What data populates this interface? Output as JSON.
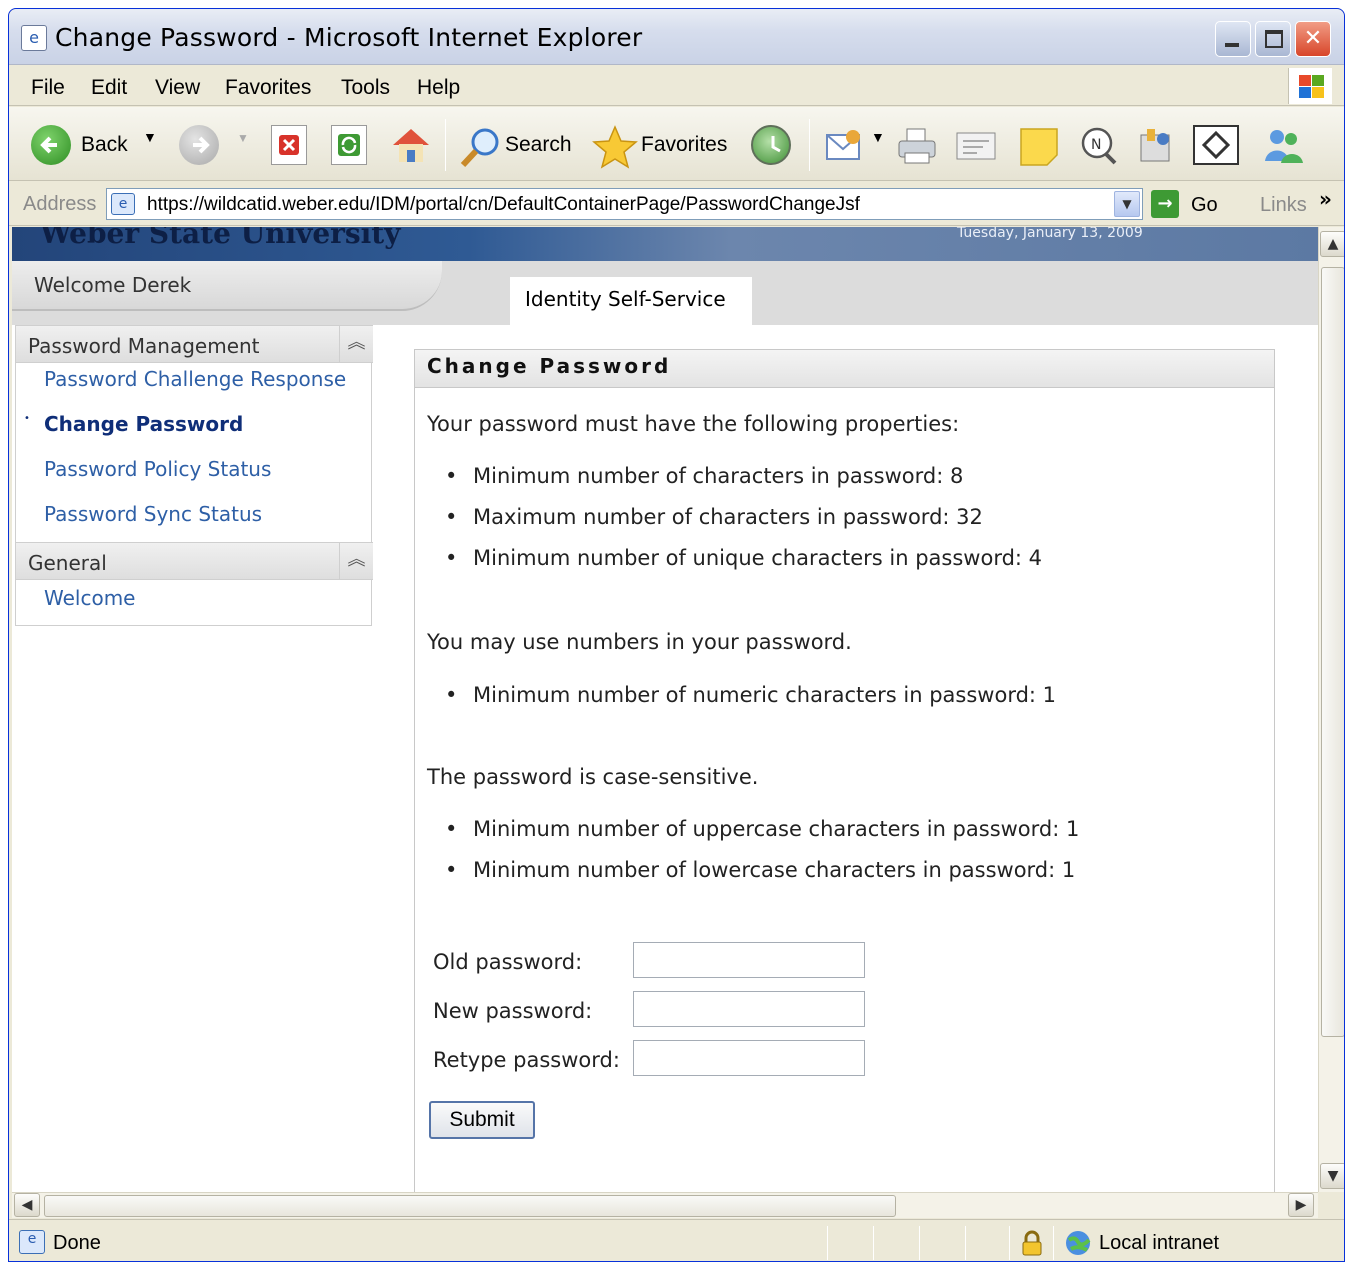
{
  "window": {
    "title": "Change Password - Microsoft Internet Explorer"
  },
  "menu": [
    "File",
    "Edit",
    "View",
    "Favorites",
    "Tools",
    "Help"
  ],
  "toolbar": {
    "back_label": "Back",
    "search_label": "Search",
    "favorites_label": "Favorites"
  },
  "address": {
    "label": "Address",
    "url": "https://wildcatid.weber.edu/IDM/portal/cn/DefaultContainerPage/PasswordChangeJsf",
    "go_label": "Go",
    "links_label": "Links",
    "more": "»"
  },
  "banner": {
    "title": "Weber State University",
    "date": "Tuesday, January 13, 2009"
  },
  "nav": {
    "welcome": "Welcome Derek",
    "active_tab": "Identity Self-Service"
  },
  "sidebar": {
    "sections": [
      {
        "title": "Password Management",
        "items": [
          {
            "label": "Password Challenge Response",
            "active": false
          },
          {
            "label": "Change Password",
            "active": true
          },
          {
            "label": "Password Policy Status",
            "active": false
          },
          {
            "label": "Password Sync Status",
            "active": false
          }
        ]
      },
      {
        "title": "General",
        "items": [
          {
            "label": "Welcome",
            "active": false
          }
        ]
      }
    ],
    "collapse_glyph": "︽"
  },
  "panel": {
    "title": "Change Password",
    "intro": "Your password must have the following properties:",
    "rules_general": [
      "Minimum number of characters in password: 8",
      "Maximum number of characters in password: 32",
      "Minimum number of unique characters in password: 4"
    ],
    "numbers_intro": "You may use numbers in your password.",
    "rules_numeric": [
      "Minimum number of numeric characters in password: 1"
    ],
    "case_intro": "The password is case-sensitive.",
    "rules_case": [
      "Minimum number of uppercase characters in password: 1",
      "Minimum number of lowercase characters in password: 1"
    ],
    "form": {
      "old_label": "Old password:",
      "old_value": "",
      "new_label": "New password:",
      "new_value": "",
      "retype_label": "Retype password:",
      "retype_value": "",
      "submit_label": "Submit"
    }
  },
  "status": {
    "text": "Done",
    "zone": "Local intranet"
  },
  "colors": {
    "link": "#2e5fa6",
    "active_link": "#0f2e78",
    "banner": "#2f5a94",
    "chrome": "#ece9d8"
  }
}
